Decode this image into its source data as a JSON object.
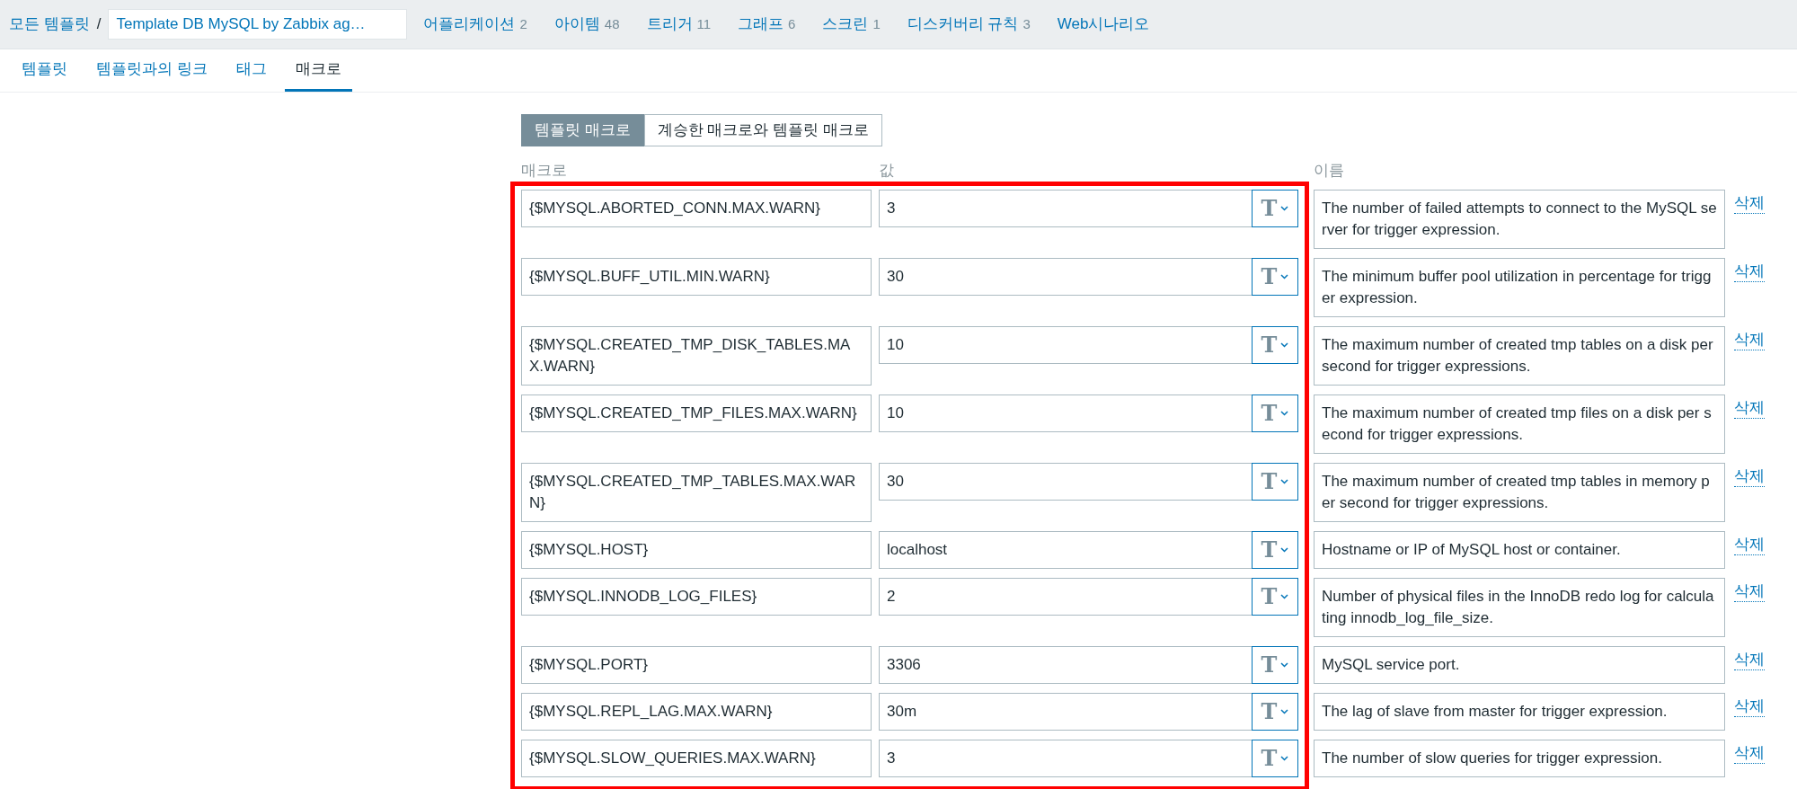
{
  "breadcrumb": {
    "root": "모든 템플릿",
    "separator": "/",
    "current": "Template DB MySQL by Zabbix ag…"
  },
  "nav": [
    {
      "label": "어플리케이션",
      "count": "2"
    },
    {
      "label": "아이템",
      "count": "48"
    },
    {
      "label": "트리거",
      "count": "11"
    },
    {
      "label": "그래프",
      "count": "6"
    },
    {
      "label": "스크린",
      "count": "1"
    },
    {
      "label": "디스커버리 규칙",
      "count": "3"
    },
    {
      "label": "Web시나리오"
    }
  ],
  "tabs": [
    {
      "label": "템플릿",
      "selected": false
    },
    {
      "label": "템플릿과의 링크",
      "selected": false
    },
    {
      "label": "태그",
      "selected": false
    },
    {
      "label": "매크로",
      "selected": true
    }
  ],
  "macro_mode": [
    {
      "label": "템플릿 매크로",
      "selected": true
    },
    {
      "label": "계승한 매크로와 템플릿 매크로",
      "selected": false
    }
  ],
  "columns": [
    "매크로",
    "값",
    "이름"
  ],
  "macros": [
    {
      "macro": "{$MYSQL.ABORTED_CONN.MAX.WARN}",
      "value": "3",
      "type": "T",
      "description": "The number of failed attempts to connect to the MySQL server for trigger expression.",
      "action": "삭제"
    },
    {
      "macro": "{$MYSQL.BUFF_UTIL.MIN.WARN}",
      "value": "30",
      "type": "T",
      "description": "The minimum buffer pool utilization in percentage for trigger expression.",
      "action": "삭제"
    },
    {
      "macro": "{$MYSQL.CREATED_TMP_DISK_TABLES.MAX.WARN}",
      "value": "10",
      "type": "T",
      "description": "The maximum number of created tmp tables on a disk per second for trigger expressions.",
      "action": "삭제"
    },
    {
      "macro": "{$MYSQL.CREATED_TMP_FILES.MAX.WARN}",
      "value": "10",
      "type": "T",
      "description": "The maximum number of created tmp files on a disk per second for trigger expressions.",
      "action": "삭제"
    },
    {
      "macro": "{$MYSQL.CREATED_TMP_TABLES.MAX.WARN}",
      "value": "30",
      "type": "T",
      "description": "The maximum number of created tmp tables in memory per second for trigger expressions.",
      "action": "삭제"
    },
    {
      "macro": "{$MYSQL.HOST}",
      "value": "localhost",
      "type": "T",
      "description": "Hostname or IP of MySQL host or container.",
      "action": "삭제"
    },
    {
      "macro": "{$MYSQL.INNODB_LOG_FILES}",
      "value": "2",
      "type": "T",
      "description": "Number of physical files in the InnoDB redo log for calculating innodb_log_file_size.",
      "action": "삭제"
    },
    {
      "macro": "{$MYSQL.PORT}",
      "value": "3306",
      "type": "T",
      "description": "MySQL service port.",
      "action": "삭제"
    },
    {
      "macro": "{$MYSQL.REPL_LAG.MAX.WARN}",
      "value": "30m",
      "type": "T",
      "description": "The lag of slave from master for trigger expression.",
      "action": "삭제"
    },
    {
      "macro": "{$MYSQL.SLOW_QUERIES.MAX.WARN}",
      "value": "3",
      "type": "T",
      "description": "The number of slow queries for trigger expression.",
      "action": "삭제"
    }
  ]
}
